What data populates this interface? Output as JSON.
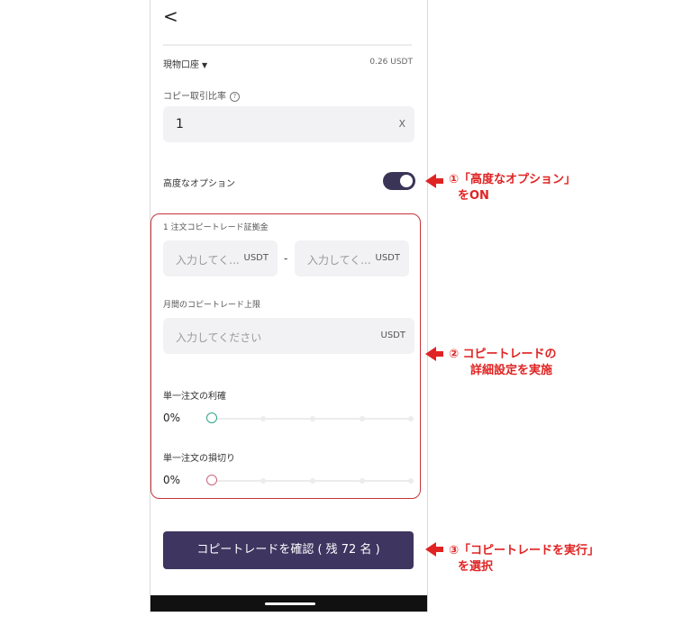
{
  "nav": {
    "back": "<"
  },
  "account": {
    "label": "現物口座",
    "caret": "▼",
    "value": "0.26 USDT"
  },
  "ratio": {
    "label": "コピー取引比率",
    "help": "?",
    "value": "1",
    "unit": "X"
  },
  "advanced": {
    "label": "高度なオプション",
    "enabled": true
  },
  "margin": {
    "label": "1 注文コピートレード証拠金",
    "min_placeholder": "入力してく...",
    "max_placeholder": "入力してく...",
    "unit": "USDT",
    "separator": "-"
  },
  "monthly": {
    "label": "月間のコピートレード上限",
    "placeholder": "入力してください",
    "unit": "USDT"
  },
  "take_profit": {
    "label": "単一注文の利確",
    "value": "0%"
  },
  "stop_loss": {
    "label": "単一注文の損切り",
    "value": "0%"
  },
  "confirm_button": "コピートレードを確認 ( 残 72 名 )",
  "annotations": {
    "a1": {
      "line1": "①「高度なオプション」",
      "line2": "をON"
    },
    "a2": {
      "line1": "② コピートレードの",
      "line2": "詳細設定を実施"
    },
    "a3": {
      "line1": "③「コピートレードを実行」",
      "line2": "を選択"
    }
  },
  "colors": {
    "accent": "#3e3560",
    "annotation": "#e02323",
    "tp_handle": "#2fa58a",
    "sl_handle": "#c9677d"
  }
}
